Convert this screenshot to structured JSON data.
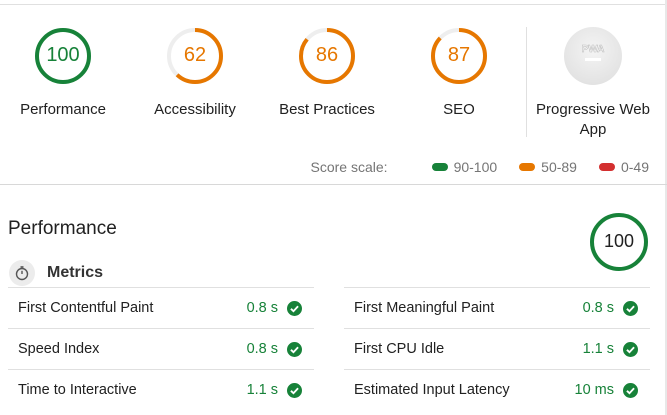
{
  "gauges": [
    {
      "score": "100",
      "label": "Performance",
      "color": "#178239",
      "track": "#e0f2e6",
      "fraction": 1.0
    },
    {
      "score": "62",
      "label": "Accessibility",
      "color": "#e67700",
      "track": "#eeeeee",
      "fraction": 0.62
    },
    {
      "score": "86",
      "label": "Best Practices",
      "color": "#e67700",
      "track": "#eeeeee",
      "fraction": 0.86
    },
    {
      "score": "87",
      "label": "SEO",
      "color": "#e67700",
      "track": "#eeeeee",
      "fraction": 0.87
    }
  ],
  "pwa": {
    "badge": "PWA",
    "label": "Progressive Web App"
  },
  "score_scale": {
    "title": "Score scale:",
    "ranges": [
      {
        "label": "90-100",
        "color": "#178239"
      },
      {
        "label": "50-89",
        "color": "#e67700"
      },
      {
        "label": "0-49",
        "color": "#d32f2f"
      }
    ]
  },
  "performance": {
    "title": "Performance",
    "score": "100",
    "color": "#178239",
    "track": "#e0f2e6"
  },
  "metrics": {
    "title": "Metrics",
    "left": [
      {
        "name": "First Contentful Paint",
        "value": "0.8 s"
      },
      {
        "name": "Speed Index",
        "value": "0.8 s"
      },
      {
        "name": "Time to Interactive",
        "value": "1.1 s"
      }
    ],
    "right": [
      {
        "name": "First Meaningful Paint",
        "value": "0.8 s"
      },
      {
        "name": "First CPU Idle",
        "value": "1.1 s"
      },
      {
        "name": "Estimated Input Latency",
        "value": "10 ms"
      }
    ],
    "pass_color": "#178239"
  }
}
